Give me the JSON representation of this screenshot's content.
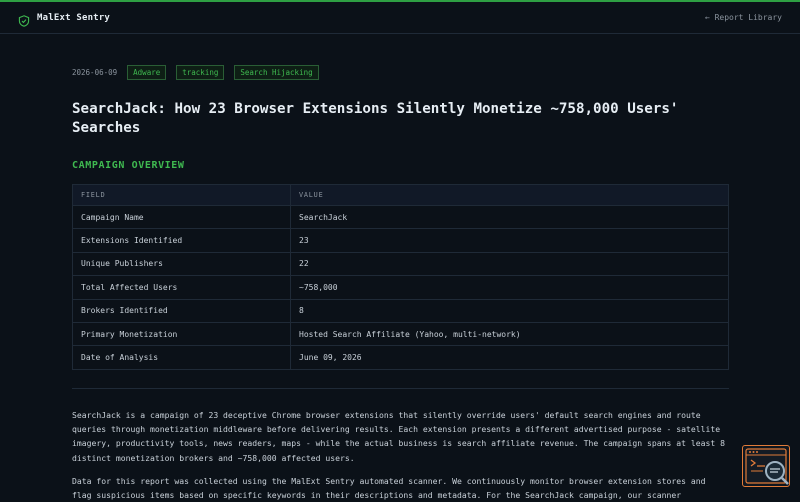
{
  "nav": {
    "brand": "MalExt Sentry",
    "back_link": "← Report Library"
  },
  "report": {
    "date": "2026-06-09",
    "tags": [
      "Adware",
      "tracking",
      "Search Hijacking"
    ],
    "title": "SearchJack: How 23 Browser Extensions Silently Monetize ~758,000 Users' Searches",
    "section_title": "CAMPAIGN OVERVIEW",
    "table": {
      "headers": [
        "FIELD",
        "VALUE"
      ],
      "rows": [
        [
          "Campaign Name",
          "SearchJack"
        ],
        [
          "Extensions Identified",
          "23"
        ],
        [
          "Unique Publishers",
          "22"
        ],
        [
          "Total Affected Users",
          "~758,000"
        ],
        [
          "Brokers Identified",
          "8"
        ],
        [
          "Primary Monetization",
          "Hosted Search Affiliate (Yahoo, multi-network)"
        ],
        [
          "Date of Analysis",
          "June 09, 2026"
        ]
      ]
    },
    "paragraphs": [
      "SearchJack is a campaign of 23 deceptive Chrome browser extensions that silently override users' default search engines and route queries through monetization middleware before delivering results. Each extension presents a different advertised purpose - satellite imagery, productivity tools, news readers, maps - while the actual business is search affiliate revenue. The campaign spans at least 8 distinct monetization brokers and ~758,000 affected users.",
      "Data for this report was collected using the MalExt Sentry automated scanner. We continuously monitor browser extension stores and flag suspicious items based on specific keywords in their descriptions and metadata. For the SearchJack campaign, our scanner"
    ]
  },
  "colors": {
    "accent": "#3fb950",
    "background": "#0b1118",
    "widget_border": "#e07b39"
  },
  "icons": {
    "brand": "shield-icon",
    "widget": "terminal-search-icon"
  }
}
